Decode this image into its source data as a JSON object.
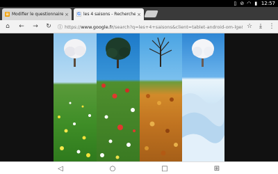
{
  "status_bar": {
    "time": "12:57",
    "icons": [
      "vibrate-icon",
      "no-sim-icon",
      "wifi-icon",
      "battery-icon"
    ]
  },
  "tabs": [
    {
      "title": "Modifier le questionnaire",
      "favicon": "forms-icon",
      "active": false
    },
    {
      "title": "les 4 saisons - Recherche Go",
      "favicon": "google-icon",
      "active": true
    }
  ],
  "toolbar": {
    "url_scheme": "https://",
    "url_domain": "www.google.fr",
    "url_path": "/search?q=les+4+saisons&client=tablet-android-om-lge&prmd="
  },
  "content": {
    "image_panels": [
      "spring",
      "summer",
      "autumn",
      "winter"
    ]
  },
  "nav_bar": {
    "buttons": [
      "back-icon",
      "home-icon",
      "recents-icon",
      "multi-window-icon"
    ]
  }
}
